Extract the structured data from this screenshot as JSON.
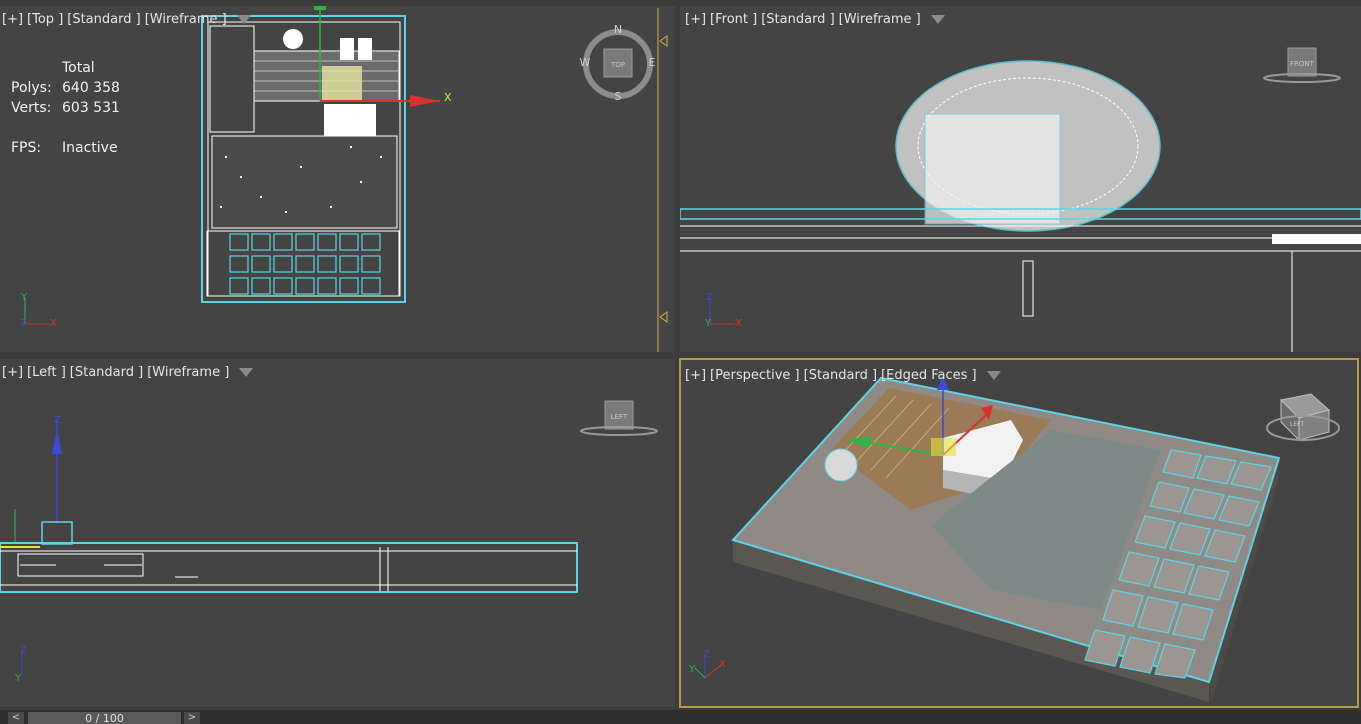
{
  "viewports": {
    "top": {
      "label": [
        "[+]",
        "[Top ]",
        "[Standard ]",
        "[Wireframe ]"
      ],
      "cube": "TOP",
      "compass": {
        "n": "N",
        "s": "S",
        "e": "E",
        "w": "W"
      },
      "gizmo_x": "X"
    },
    "front": {
      "label": [
        "[+]",
        "[Front ]",
        "[Standard ]",
        "[Wireframe ]"
      ],
      "cube": "FRONT"
    },
    "left": {
      "label": [
        "[+]",
        "[Left ]",
        "[Standard ]",
        "[Wireframe ]"
      ],
      "cube": "LEFT"
    },
    "perspective": {
      "label": [
        "[+]",
        "[Perspective ]",
        "[Standard ]",
        "[Edged Faces ]"
      ],
      "cube": "LEFT"
    }
  },
  "stats": {
    "header": "Total",
    "polys_label": "Polys:",
    "polys": "640 358",
    "verts_label": "Verts:",
    "verts": "603 531",
    "fps_label": "FPS:",
    "fps": "Inactive"
  },
  "axes": {
    "x": "X",
    "y": "Y",
    "z": "Z"
  },
  "timeline": {
    "prev": "<",
    "next": ">",
    "frame": "0 / 100"
  },
  "colors": {
    "viewport_bg": "#444444",
    "active_border": "#b89a46",
    "selection": "#5fd3e6"
  }
}
